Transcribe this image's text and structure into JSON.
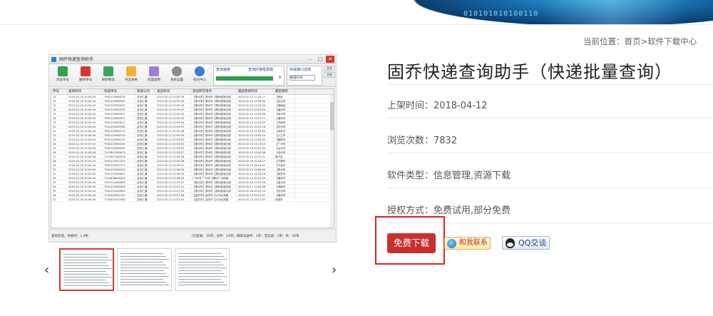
{
  "banner": {
    "digits": "010101010100110"
  },
  "breadcrumb": {
    "prefix": "当前位置：",
    "home": "首页",
    "sep": ">",
    "section": "软件下载中心"
  },
  "app_window": {
    "title": "固乔快递查询助手",
    "toolbar": [
      "添加单号",
      "删除单号",
      "刷新物流",
      "导出表格",
      "批量复制",
      "系统设置",
      "会员中心"
    ],
    "query_box": {
      "label": "查询速度",
      "checkbox": "查询时弹框报错",
      "value": "快",
      "pct": "9"
    },
    "select_box": {
      "label": "快递接口选择",
      "value": "快递100"
    },
    "side_buttons": [
      "全选",
      "全选"
    ],
    "columns": [
      "序号",
      "查询时间",
      "快递单号",
      "快递公司",
      "发出时间",
      "发出所在地点",
      "最后更新时间",
      "最后更新"
    ],
    "rows": [
      [
        "13",
        "2019-02-16 15:00:43",
        "7902125560574",
        "百世汇通",
        "2019-02-12 22:55:39",
        "【泰州市】泰州市【泰州航城分部",
        "2019-02-15 11:03:17",
        "【快运"
      ],
      [
        "14",
        "2019-02-16 15:00:43",
        "7902125560545",
        "百世汇通",
        "2019-02-12 22:55:39",
        "【泰州市】泰州市【泰州航城分部",
        "2019-02-15 13:26:40",
        "【武汉市"
      ],
      [
        "15",
        "2019-02-16 15:00:43",
        "7902125563470",
        "百世汇通",
        "2019-02-12 22:55:40",
        "【泰州市】泰州市【泰州航城分部",
        "2019-02-15 13:25:34",
        "【湖南省"
      ],
      [
        "16",
        "2019-02-16 15:00:43",
        "7902125562520",
        "百世汇通",
        "2019-02-12 22:55:42",
        "【泰州市】泰州市【泰州航城分部",
        "2019-02-15 10:04:34",
        "【福州市"
      ],
      [
        "17",
        "2019-02-16 15:00:43",
        "7902125560521",
        "百世汇通",
        "2019-02-12 22:55:42",
        "【泰州市】泰州市【泰州航城分部",
        "2019-02-15 14:45:46",
        "【徐州市"
      ],
      [
        "18",
        "2019-02-16 15:00:43",
        "7902125562617",
        "百世汇通",
        "2019-02-12 22:55:44",
        "【泰州市】泰州市【泰州航城分部",
        "2019-02-15 13:10:11",
        "【潮州市"
      ],
      [
        "19",
        "2019-02-16 15:00:43",
        "7902125563021",
        "百世汇通",
        "2019-02-12 22:55:44",
        "【泰州市】泰州市【泰州航城分部",
        "2019-02-15 11:33:55",
        "【济南市"
      ],
      [
        "20",
        "2019-02-16 15:00:44",
        "7902125563160",
        "百世汇通",
        "2019-02-12 22:55:47",
        "【泰州市】泰州市【泰州航城分部",
        "2019-02-15 10:20:16",
        "【杭州市"
      ],
      [
        "21",
        "2019-02-16 15:00:44",
        "7902125562513",
        "百世汇通",
        "2019-02-12 22:55:48",
        "【泰州市】泰州市【泰州航城分部",
        "2019-02-15 17:09:04",
        "【安庆市"
      ],
      [
        "22",
        "2019-02-16 15:00:44",
        "7902125560510",
        "百世汇通",
        "2019-02-12 22:55:49",
        "【泰州市】泰州市【泰州航城分部",
        "2019-02-15 15:02:14",
        "【九江市"
      ],
      [
        "23",
        "2019-02-16 15:00:44",
        "7902125560170",
        "百世汇通",
        "2019-02-12 22:55:50",
        "【泰州市】泰州市【泰州航城分部",
        "2019-02-15 21:59:03",
        "【襄阳市"
      ],
      [
        "24",
        "2019-02-16 15:07:10",
        "7902125560150",
        "百世汇通",
        "2019-02-12 22:55:55",
        "【泰州市】泰州市【泰州航城分部",
        "2019-02-15 15:13:15",
        "【广州市"
      ],
      [
        "25",
        "2019-02-16 15:00:44",
        "7902125560092",
        "百世汇通",
        "2019-02-12 22:55:55",
        "【泰州市】泰州市【泰州航城分部",
        "2019-02-16 05:02:30",
        "【汕头市"
      ],
      [
        "26",
        "2019-02-16 15:00:44",
        "7147607260873",
        "百世汇通",
        "2019-02-12 22:55:57",
        "【泰州市】泰州市【泰州航城分部",
        "2019-02-15 14:30:36",
        "【沧州市"
      ],
      [
        "27",
        "2019-02-16 15:00:44",
        "7147607260578",
        "百世汇通",
        "2019-02-12 22:55:58",
        "【泰州市】泰州市【泰州航城分部",
        "2019-02-15 15:15:21",
        "新户区"
      ],
      [
        "28",
        "2019-02-16 15:07:10",
        "7902125427225",
        "百世汇通",
        "2019-02-12 22:56:28",
        "【泰州市】泰州市【泰州航城分部",
        "2019-02-16 10:43:17",
        "【宁德市"
      ],
      [
        "29",
        "2019-02-16 15:00:44",
        "7902125567072",
        "百世汇通",
        "2019-02-12 22:56:31",
        "【泰州市】泰州市【泰州航城分部",
        "2019-02-15 16:18:07",
        "【宁波市"
      ],
      [
        "30",
        "2019-02-16 15:00:45",
        "7902125560505",
        "百世汇通",
        "2019-02-12 22:56:33",
        "【泰州市】泰州市【泰州航城分部",
        "2019-02-15 19:08:59",
        "【泉州市"
      ],
      [
        "31",
        "2019-02-16 15:00:45",
        "7902125560631",
        "百世汇通",
        "2019-02-12 22:56:40",
        "【泰州市】泰州市【泰州航城分部",
        "2019-02-14 14:30:16",
        "【西安市"
      ],
      [
        "32",
        "2019-02-16 15:00:45",
        "7125836858015",
        "百世汇通",
        "2019-02-12 22:56:44",
        "广州市】广州市【韩中广分拨部",
        "2019-02-14 20:07:49",
        "【重庆市"
      ],
      [
        "33",
        "2019-02-16 15:00:45",
        "7902125460694",
        "百世汇通",
        "2019-02-12 22:57:22",
        "【泰州市】泰州市【泰州航城分部",
        "2019-02-16 12:29:58",
        "【温州市"
      ],
      [
        "34",
        "2019-02-16 15:00:45",
        "7902125460094",
        "百世汇通",
        "2019-02-12 22:57:22",
        "【泰州市】泰州市【泰州航城分部",
        "2019-02-17 11:56:58",
        "【海南市"
      ],
      [
        "35",
        "2019-02-16 15:00:45",
        "7902125182605",
        "百世汇通",
        "2019-02-12 22:57:35",
        "【泰州市】泰州市【泰州航城分部",
        "2019-02-16 20:07:25",
        "【杭州市"
      ],
      [
        "36",
        "2019-02-16 15:00:45",
        "7132444052755",
        "百世汇通",
        "2019-02-12 22:57:38",
        "【金华市】金华市【义乌北苑集",
        "2019-02-15 09:41:42",
        "【重庆市"
      ],
      [
        "37",
        "2019-02-16 15:00:45",
        "7132404752930",
        "百世汇通",
        "2019-02-12 22:57:43",
        "【金华市】金华市【义乌北苑集",
        "2019-02-15 14:11:37",
        "深圳市"
      ]
    ],
    "status_left": "查询完成，共耗时：1.4秒",
    "status_right": "[已签收：15单；派件：14单；揭取派送中：1单；无信息：1单；共：30单"
  },
  "carousel": {
    "prev": "‹",
    "next": "›",
    "thumbs": 3,
    "active_index": 0
  },
  "product": {
    "title": "固乔快递查询助手（快递批量查询）",
    "release_label": "上架时间：",
    "release": "2018-04-12",
    "views_label": "浏览次数：",
    "views": "7832",
    "type_label": "软件类型：",
    "type": "信息管理,资源下载",
    "license_label": "授权方式：",
    "license": "免费试用,部分免费"
  },
  "actions": {
    "download": "免费下载",
    "contact": "和我联系",
    "qq": "QQ交谈"
  },
  "colors": {
    "accent": "#c92f2f",
    "highlight": "#e02020",
    "banner": "#1769a8"
  }
}
